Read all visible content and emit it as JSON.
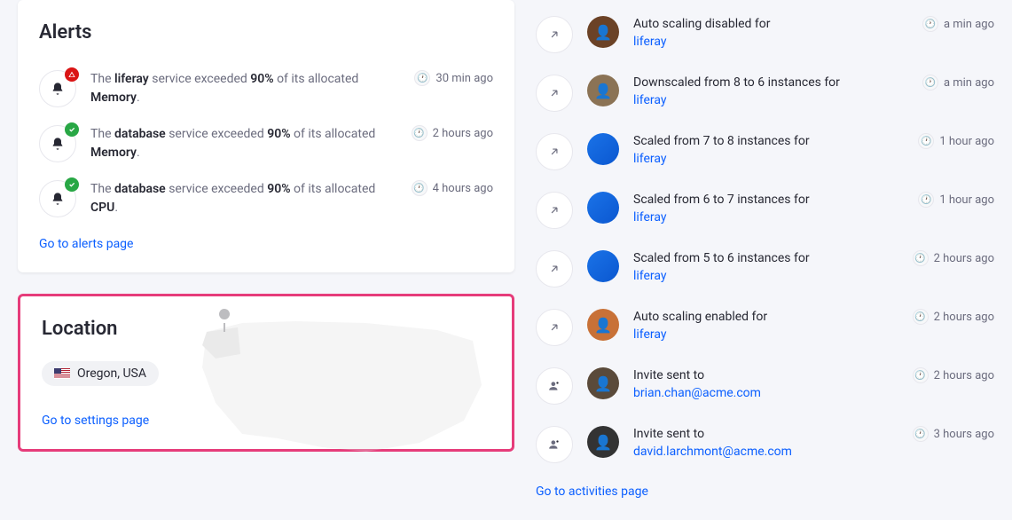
{
  "alerts": {
    "title": "Alerts",
    "items": [
      {
        "status": "warn",
        "pre": "The ",
        "svc": "liferay",
        "mid": " service exceeded ",
        "pct": "90%",
        "end": " of its allocated ",
        "res": "Memory",
        "dot": ".",
        "time": "30 min ago"
      },
      {
        "status": "ok",
        "pre": "The ",
        "svc": "database",
        "mid": " service exceeded ",
        "pct": "90%",
        "end": " of its allocated ",
        "res": "Memory",
        "dot": ".",
        "time": "2 hours ago"
      },
      {
        "status": "ok",
        "pre": "The ",
        "svc": "database",
        "mid": " service exceeded ",
        "pct": "90%",
        "end": " of its allocated ",
        "res": "CPU",
        "dot": ".",
        "time": "4 hours ago"
      }
    ],
    "link": "Go to alerts page"
  },
  "location": {
    "title": "Location",
    "place": "Oregon, USA",
    "link": "Go to settings page"
  },
  "activities": {
    "items": [
      {
        "icon": "arrow",
        "avatar": "user1",
        "pre": "Auto scaling disabled for",
        "link": "liferay",
        "time": "a min ago"
      },
      {
        "icon": "arrow",
        "avatar": "user2",
        "pre": "Downscaled from 8 to 6 instances for",
        "link": "liferay",
        "time": "a min ago"
      },
      {
        "icon": "arrow",
        "avatar": "user3",
        "pre": "Scaled from 7 to 8 instances for",
        "link": "liferay",
        "time": "1 hour ago"
      },
      {
        "icon": "arrow",
        "avatar": "user3",
        "pre": "Scaled from 6 to 7 instances for",
        "link": "liferay",
        "time": "1 hour ago"
      },
      {
        "icon": "arrow",
        "avatar": "user3",
        "pre": "Scaled from 5 to 6 instances for",
        "link": "liferay",
        "time": "2 hours ago"
      },
      {
        "icon": "arrow",
        "avatar": "user4",
        "pre": "Auto scaling enabled for",
        "link": "liferay",
        "time": "2 hours ago"
      },
      {
        "icon": "user",
        "avatar": "user5",
        "pre": "Invite sent to",
        "link": "brian.chan@acme.com",
        "time": "2 hours ago"
      },
      {
        "icon": "user",
        "avatar": "user6",
        "pre": "Invite sent to",
        "link": "david.larchmont@acme.com",
        "time": "3 hours ago"
      }
    ],
    "link": "Go to activities page"
  }
}
